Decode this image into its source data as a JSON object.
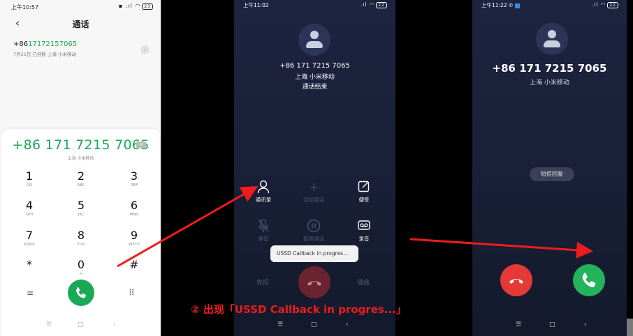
{
  "dialer": {
    "status_time": "上午10:57",
    "status_icons": "▪ .ıl ◠",
    "battery": "23",
    "title": "通话",
    "recent_prefix": "+86",
    "recent_digits": "17172157065",
    "recent_sub": "7月21日 已挂断  上海 小米移动",
    "number": "+86 171 7215 7065",
    "location": "上海 小米移动",
    "keys": [
      {
        "digit": "1",
        "letters": "QD"
      },
      {
        "digit": "2",
        "letters": "ABC"
      },
      {
        "digit": "3",
        "letters": "DEF"
      },
      {
        "digit": "4",
        "letters": "GHI"
      },
      {
        "digit": "5",
        "letters": "JKL"
      },
      {
        "digit": "6",
        "letters": "MNO"
      },
      {
        "digit": "7",
        "letters": "PQRS"
      },
      {
        "digit": "8",
        "letters": "TUV"
      },
      {
        "digit": "9",
        "letters": "WXYZ"
      },
      {
        "digit": "*",
        "letters": ""
      },
      {
        "digit": "0",
        "letters": "+"
      },
      {
        "digit": "#",
        "letters": ""
      }
    ],
    "nav": [
      "☰",
      "□",
      "‹"
    ]
  },
  "ended": {
    "status_time": "上午11:02",
    "status_icons": ".ıl ◠",
    "battery": "22",
    "number": "+86 171 7215 7065",
    "location": "上海 小米移动",
    "state": "通话结束",
    "actions": [
      {
        "icon": "contacts-icon",
        "label": "通讯录"
      },
      {
        "icon": "add-call-icon",
        "label": "添加通话"
      },
      {
        "icon": "note-icon",
        "label": "便签"
      },
      {
        "icon": "mute-icon",
        "label": "静音"
      },
      {
        "icon": "pause-icon",
        "label": "暂停通话"
      },
      {
        "icon": "record-icon",
        "label": "录音"
      }
    ],
    "toast": "USSD Callback in progres...",
    "speaker": "免提",
    "keypad": "键盘",
    "nav": [
      "☰",
      "□",
      "‹"
    ]
  },
  "incoming": {
    "status_time": "上午11:22",
    "status_icons": ".ıl ◠",
    "battery": "22",
    "number": "+86 171 7215 7065",
    "location": "上海 小米移动",
    "sms_reply": "短信回复",
    "nav": [
      "☰",
      "□",
      "‹"
    ]
  },
  "annotation": {
    "caption": "② 出现「USSD Callback in progres...」",
    "color": "#ee1c1c"
  },
  "colors": {
    "green": "#1aaa55",
    "red": "#e53935",
    "dark_bg": "#1a2038"
  }
}
